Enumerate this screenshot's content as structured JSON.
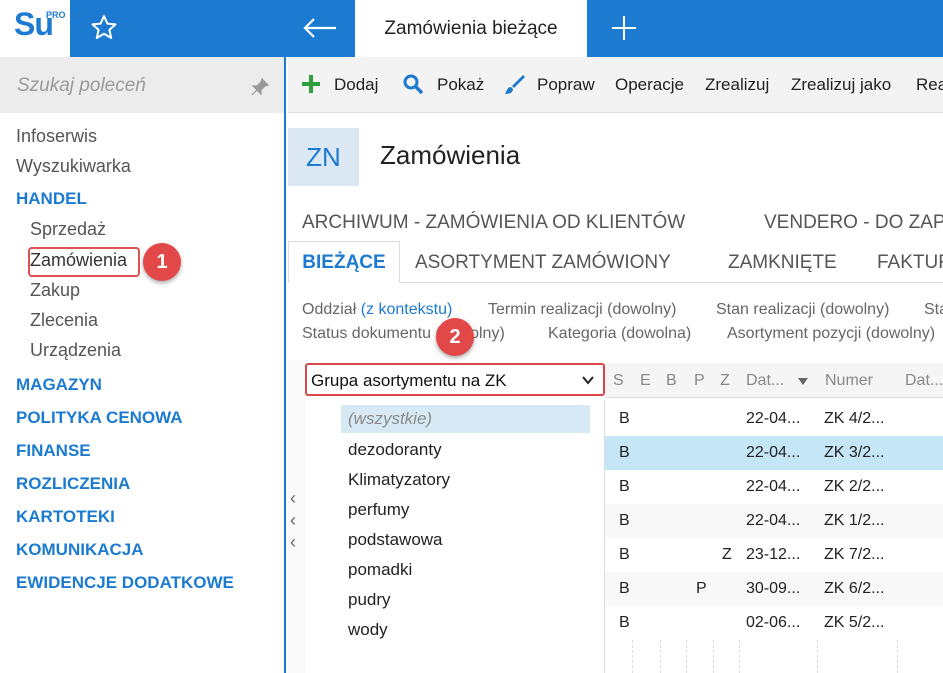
{
  "app": {
    "logo_text": "Su",
    "logo_sup": "PRO",
    "active_tab": "Zamówienia bieżące"
  },
  "sidebar": {
    "search_placeholder": "Szukaj poleceń",
    "items": [
      "Infoserwis",
      "Wyszukiwarka"
    ],
    "handel": {
      "label": "HANDEL",
      "children": [
        "Sprzedaż",
        "Zamówienia",
        "Zakup",
        "Zlecenia",
        "Urządzenia"
      ]
    },
    "sections": [
      "MAGAZYN",
      "POLITYKA CENOWA",
      "FINANSE",
      "ROZLICZENIA",
      "KARTOTEKI",
      "KOMUNIKACJA",
      "EWIDENCJE DODATKOWE"
    ]
  },
  "badges": [
    "1",
    "2"
  ],
  "toolbar": {
    "add": "Dodaj",
    "show": "Pokaż",
    "edit": "Popraw",
    "operations": "Operacje",
    "realize": "Zrealizuj",
    "realize_as": "Zrealizuj jako",
    "more": "Rea"
  },
  "header": {
    "code": "ZN",
    "title": "Zamówienia"
  },
  "archive_tabs": [
    "ARCHIWUM - ZAMÓWIENIA OD KLIENTÓW",
    "VENDERO - DO ZAP"
  ],
  "subtabs": {
    "active": "BIEŻĄCE",
    "others": [
      "ASORTYMENT ZAMÓWIONY",
      "ZAMKNIĘTE",
      "FAKTUR"
    ]
  },
  "filters": {
    "branch_label": "Oddział",
    "branch_value": "(z kontekstu)",
    "term": "Termin realizacji (dowolny)",
    "state": "Stan realizacji (dowolny)",
    "st_more": "Sta",
    "doc_status": "Status dokumentu (dowolny)",
    "category": "Kategoria (dowolna)",
    "assortment": "Asortyment pozycji (dowolny)"
  },
  "group_panel": {
    "select_value": "Grupa asortymentu na ZK",
    "items": [
      "(wszystkie)",
      "dezodoranty",
      "Klimatyzatory",
      "perfumy",
      "podstawowa",
      "pomadki",
      "pudry",
      "wody"
    ]
  },
  "grid": {
    "columns": [
      "S",
      "E",
      "B",
      "P",
      "Z",
      "Dat...",
      "Numer",
      "Dat..."
    ],
    "rows": [
      [
        "B",
        "",
        "",
        "",
        "",
        "22-04...",
        "ZK 4/2..."
      ],
      [
        "B",
        "",
        "",
        "",
        "",
        "22-04...",
        "ZK 3/2..."
      ],
      [
        "B",
        "",
        "",
        "",
        "",
        "22-04...",
        "ZK 2/2..."
      ],
      [
        "B",
        "",
        "",
        "",
        "",
        "22-04...",
        "ZK 1/2..."
      ],
      [
        "B",
        "",
        "",
        "",
        "Z",
        "23-12...",
        "ZK 7/2..."
      ],
      [
        "B",
        "",
        "",
        "P",
        "",
        "30-09...",
        "ZK 6/2..."
      ],
      [
        "B",
        "",
        "",
        "",
        "",
        "02-06...",
        "ZK 5/2..."
      ]
    ],
    "selected_row": 1
  },
  "colors": {
    "accent": "#1c7bd1",
    "badge": "#e24848",
    "selection": "#c5e6f7"
  }
}
